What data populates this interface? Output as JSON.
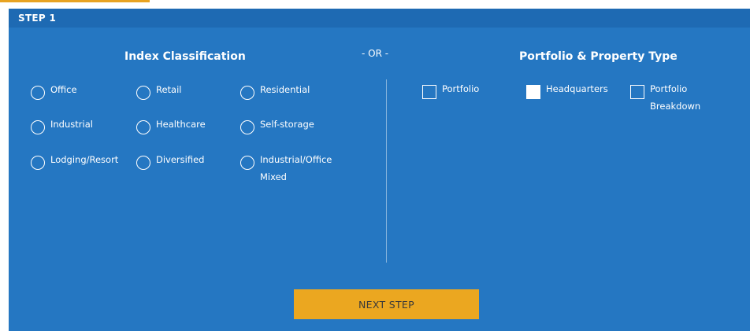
{
  "step": {
    "label": "STEP 1"
  },
  "index_classification": {
    "title": "Index Classification",
    "options": [
      {
        "label": "Office"
      },
      {
        "label": "Retail"
      },
      {
        "label": "Residential"
      },
      {
        "label": "Industrial"
      },
      {
        "label": "Healthcare"
      },
      {
        "label": "Self-storage"
      },
      {
        "label": "Lodging/Resort"
      },
      {
        "label": "Diversified"
      },
      {
        "label": "Industrial/Office Mixed"
      }
    ]
  },
  "separator": {
    "label": "- OR -"
  },
  "portfolio_property": {
    "title": "Portfolio & Property Type",
    "options": [
      {
        "label": "Portfolio",
        "checked": false
      },
      {
        "label": "Headquarters",
        "checked": true
      },
      {
        "label": "Portfolio Breakdown",
        "checked": false
      }
    ]
  },
  "next_button": {
    "label": "NEXT STEP"
  },
  "colors": {
    "panel": "#2577c2",
    "header": "#1e6ab3",
    "button": "#eba720",
    "text": "#ffffff"
  }
}
